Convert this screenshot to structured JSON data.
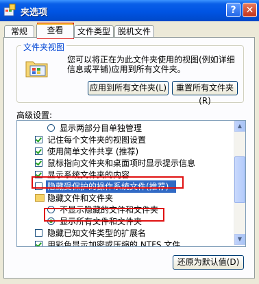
{
  "window": {
    "title": "文件夹选项",
    "title_visible": "夹选项",
    "help_label": "?",
    "close_label": "✕"
  },
  "tabs": [
    {
      "label": "常规"
    },
    {
      "label": "查看",
      "active": true
    },
    {
      "label": "文件类型"
    },
    {
      "label": "脱机文件"
    }
  ],
  "folder_views": {
    "group_title": "文件夹视图",
    "description": "您可以将正在为此文件夹使用的视图(例如详细信息或平铺)应用到所有文件夹。",
    "apply_all_label": "应用到所有文件夹(L)",
    "reset_all_label": "重置所有文件夹(R)"
  },
  "advanced": {
    "label": "高级设置:",
    "items": [
      {
        "type": "radio",
        "checked": false,
        "label": "显示两部分目单独管理"
      },
      {
        "type": "checkbox",
        "checked": true,
        "label": "记住每个文件夹的视图设置"
      },
      {
        "type": "checkbox",
        "checked": true,
        "label": "使用简单文件共享 (推荐)"
      },
      {
        "type": "checkbox",
        "checked": true,
        "label": "鼠标指向文件夹和桌面项时显示提示信息"
      },
      {
        "type": "checkbox",
        "checked": true,
        "label": "显示系统文件夹的内容"
      },
      {
        "type": "checkbox",
        "checked": false,
        "selected": true,
        "label": "隐藏受保护的操作系统文件(推荐)"
      },
      {
        "type": "folder",
        "label": "隐藏文件和文件夹"
      },
      {
        "type": "radio",
        "checked": false,
        "label": "不显示隐藏的文件和文件夹"
      },
      {
        "type": "radio",
        "checked": true,
        "label": "显示所有文件和文件夹"
      },
      {
        "type": "checkbox",
        "checked": false,
        "label": "隐藏已知文件类型的扩展名"
      },
      {
        "type": "checkbox",
        "checked": true,
        "label": "用彩色显示加密或压缩的 NTFS 文件"
      }
    ]
  },
  "restore_defaults_label": "还原为默认值(D)",
  "colors": {
    "accent": "#0054e3",
    "highlight": "#e01010",
    "selection": "#316ac5",
    "check": "#21a121"
  },
  "icons": [
    "folder-options-icon",
    "help-icon",
    "close-icon",
    "folder-view-icon",
    "folder-icon",
    "scroll-up-icon",
    "scroll-down-icon"
  ]
}
